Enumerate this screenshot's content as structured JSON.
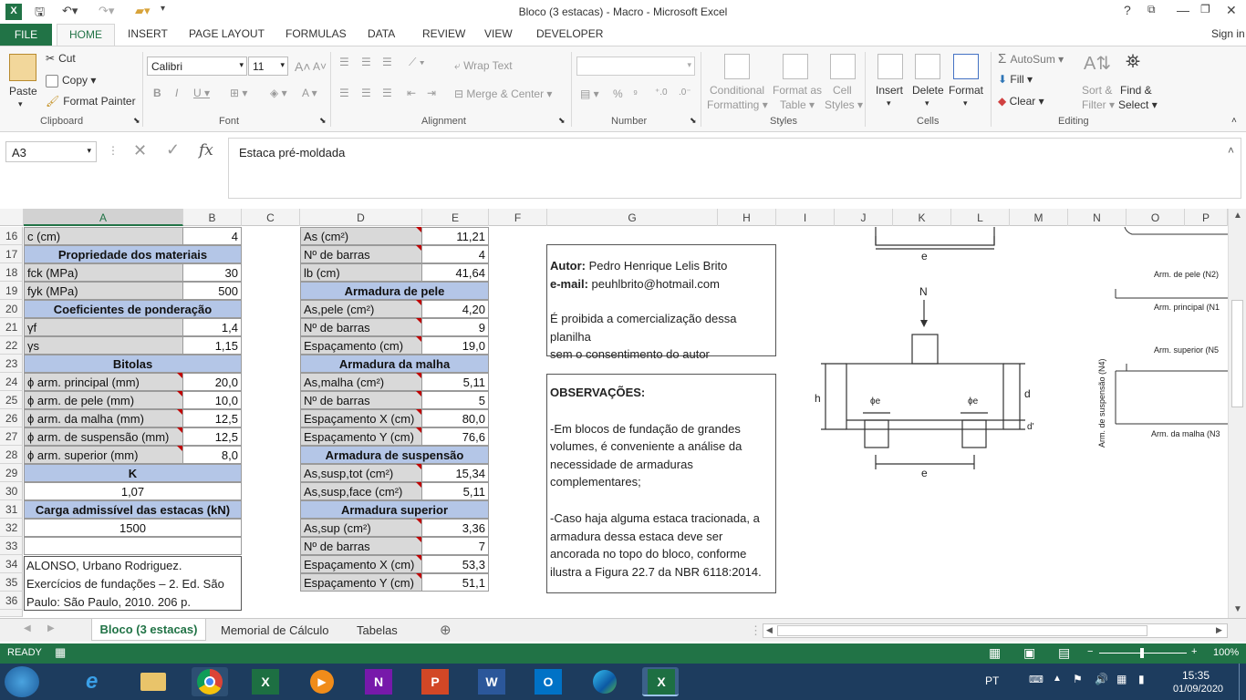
{
  "window": {
    "title": "Bloco (3 estacas) - Macro - Microsoft Excel",
    "help": "?"
  },
  "tabs": {
    "file": "FILE",
    "home": "HOME",
    "insert": "INSERT",
    "page_layout": "PAGE LAYOUT",
    "formulas": "FORMULAS",
    "data": "DATA",
    "review": "REVIEW",
    "view": "VIEW",
    "developer": "DEVELOPER",
    "signin": "Sign in"
  },
  "ribbon": {
    "clipboard": {
      "paste": "Paste",
      "cut": "Cut",
      "copy": "Copy",
      "format_painter": "Format Painter",
      "label": "Clipboard"
    },
    "font": {
      "name": "Calibri",
      "size": "11",
      "label": "Font"
    },
    "alignment": {
      "wrap": "Wrap Text",
      "merge": "Merge & Center",
      "label": "Alignment"
    },
    "number": {
      "label": "Number"
    },
    "styles": {
      "conditional": "Conditional",
      "formatting": "Formatting",
      "format_as": "Format as",
      "table": "Table",
      "cell": "Cell",
      "cell_styles": "Styles",
      "label": "Styles"
    },
    "cells": {
      "insert": "Insert",
      "delete": "Delete",
      "format": "Format",
      "label": "Cells"
    },
    "editing": {
      "autosum": "AutoSum",
      "fill": "Fill",
      "clear": "Clear",
      "sort": "Sort &",
      "filter": "Filter",
      "find": "Find &",
      "select": "Select",
      "label": "Editing"
    }
  },
  "formula_bar": {
    "name_box": "A3",
    "content": "Estaca pré-moldada"
  },
  "columns": [
    "A",
    "B",
    "C",
    "D",
    "E",
    "F",
    "G",
    "H",
    "I",
    "J",
    "K",
    "L",
    "M",
    "N",
    "O",
    "P"
  ],
  "rows": [
    "16",
    "17",
    "18",
    "19",
    "20",
    "21",
    "22",
    "23",
    "24",
    "25",
    "26",
    "27",
    "28",
    "29",
    "30",
    "31",
    "32",
    "33",
    "34",
    "35",
    "36"
  ],
  "left_table": {
    "r16": {
      "label": "c (cm)",
      "value": "4"
    },
    "r17": "Propriedade dos materiais",
    "r18": {
      "label": "fck (MPa)",
      "value": "30"
    },
    "r19": {
      "label": "fyk (MPa)",
      "value": "500"
    },
    "r20": "Coeficientes de ponderação",
    "r21": {
      "label": "γf",
      "value": "1,4"
    },
    "r22": {
      "label": "γs",
      "value": "1,15"
    },
    "r23": "Bitolas",
    "r24": {
      "label": "ϕ arm. principal (mm)",
      "value": "20,0"
    },
    "r25": {
      "label": "ϕ arm. de pele (mm)",
      "value": "10,0"
    },
    "r26": {
      "label": "ϕ arm. da malha (mm)",
      "value": "12,5"
    },
    "r27": {
      "label": "ϕ arm. de suspensão (mm)",
      "value": "12,5"
    },
    "r28": {
      "label": "ϕ arm. superior (mm)",
      "value": "8,0"
    },
    "r29": "K",
    "r30": "1,07",
    "r31": "Carga admissível das estacas (kN)",
    "r32": "1500",
    "ref1": "ALONSO, Urbano Rodriguez.",
    "ref2": "Exercícios de fundações – 2. Ed. São",
    "ref3": "Paulo: São Paulo, 2010. 206 p."
  },
  "mid_table": {
    "r16": {
      "label": "As (cm²)",
      "value": "11,21"
    },
    "r17": {
      "label": "Nº de barras",
      "value": "4"
    },
    "r18": {
      "label": "lb (cm)",
      "value": "41,64"
    },
    "r19": "Armadura de pele",
    "r20": {
      "label": "As,pele (cm²)",
      "value": "4,20"
    },
    "r21": {
      "label": "Nº de barras",
      "value": "9"
    },
    "r22": {
      "label": "Espaçamento (cm)",
      "value": "19,0"
    },
    "r23": "Armadura da malha",
    "r24": {
      "label": "As,malha (cm²)",
      "value": "5,11"
    },
    "r25": {
      "label": "Nº de barras",
      "value": "5"
    },
    "r26": {
      "label": "Espaçamento X (cm)",
      "value": "80,0"
    },
    "r27": {
      "label": "Espaçamento Y (cm)",
      "value": "76,6"
    },
    "r28": "Armadura de suspensão",
    "r29": {
      "label": "As,susp,tot (cm²)",
      "value": "15,34"
    },
    "r30": {
      "label": "As,susp,face (cm²)",
      "value": "5,11"
    },
    "r31": "Armadura superior",
    "r32": {
      "label": "As,sup (cm²)",
      "value": "3,36"
    },
    "r33": {
      "label": "Nº de barras",
      "value": "7"
    },
    "r34": {
      "label": "Espaçamento X (cm)",
      "value": "53,3"
    },
    "r35": {
      "label": "Espaçamento Y (cm)",
      "value": "51,1"
    }
  },
  "author_box": {
    "author_label": "Autor:",
    "author": "Pedro Henrique Lelis Brito",
    "email_label": "e-mail:",
    "email": "peuhlbrito@hotmail.com",
    "notice1": "É proibida a comercialização dessa planilha",
    "notice2": "sem o consentimento do autor"
  },
  "obs_box": {
    "title": "OBSERVAÇÕES:",
    "l1": "-Em blocos de fundação de grandes",
    "l2": "volumes, é conveniente a análise da",
    "l3": "necessidade de armaduras",
    "l4": "complementares;",
    "l5": "-Caso haja alguma estaca tracionada, a",
    "l6": "armadura dessa estaca deve ser",
    "l7": "ancorada no topo do bloco, conforme",
    "l8": "ilustra a Figura 22.7 da NBR 6118:2014."
  },
  "diagram": {
    "e_top": "e",
    "N": "N",
    "h": "h",
    "d": "d",
    "dprime": "d'",
    "phi1": "ϕe",
    "phi2": "ϕe",
    "e_bottom": "e"
  },
  "diagram2": {
    "pele": "Arm. de pele (N2)",
    "principal": "Arm. principal (N1",
    "superior": "Arm. superior (N5",
    "suspensao": "Arm. de suspensão (N4)",
    "malha": "Arm. da malha (N3"
  },
  "sheets": {
    "s1": "Bloco (3 estacas)",
    "s2": "Memorial de Cálculo",
    "s3": "Tabelas"
  },
  "statusbar": {
    "ready": "READY",
    "zoom": "100%"
  },
  "taskbar": {
    "lang": "PT",
    "time": "15:35",
    "date": "01/09/2020"
  }
}
